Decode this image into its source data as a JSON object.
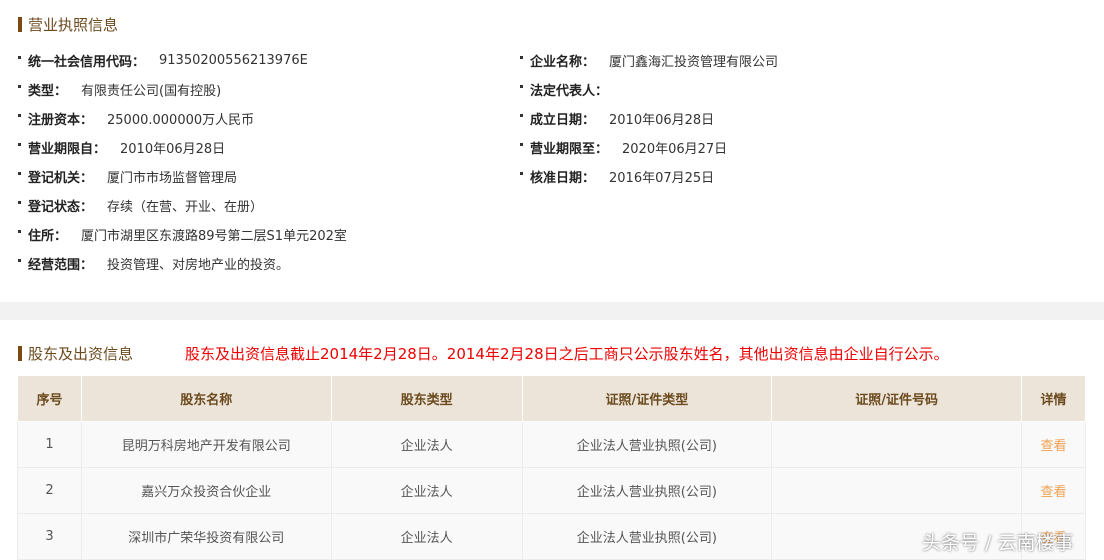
{
  "license": {
    "title": "营业执照信息",
    "left": [
      {
        "label": "统一社会信用代码：",
        "value": "91350200556213976E"
      },
      {
        "label": "类型：",
        "value": "有限责任公司(国有控股)"
      },
      {
        "label": "注册资本：",
        "value": "25000.000000万人民币"
      },
      {
        "label": "营业期限自：",
        "value": "2010年06月28日"
      },
      {
        "label": "登记机关：",
        "value": "厦门市市场监督管理局"
      },
      {
        "label": "登记状态：",
        "value": "存续（在营、开业、在册）"
      },
      {
        "label": "住所：",
        "value": "厦门市湖里区东渡路89号第二层S1单元202室"
      },
      {
        "label": "经营范围：",
        "value": "投资管理、对房地产业的投资。"
      }
    ],
    "right": [
      {
        "label": "企业名称：",
        "value": "厦门鑫海汇投资管理有限公司"
      },
      {
        "label": "法定代表人：",
        "value": ""
      },
      {
        "label": "成立日期：",
        "value": "2010年06月28日"
      },
      {
        "label": "营业期限至：",
        "value": "2020年06月27日"
      },
      {
        "label": "核准日期：",
        "value": "2016年07月25日"
      }
    ]
  },
  "shareholders": {
    "title": "股东及出资信息",
    "notice": "股东及出资信息截止2014年2月28日。2014年2月28日之后工商只公示股东姓名，其他出资信息由企业自行公示。",
    "headers": [
      "序号",
      "股东名称",
      "股东类型",
      "证照/证件类型",
      "证照/证件号码",
      "详情"
    ],
    "rows": [
      [
        "1",
        "昆明万科房地产开发有限公司",
        "企业法人",
        "企业法人营业执照(公司)",
        "",
        "查看"
      ],
      [
        "2",
        "嘉兴万众投资合伙企业",
        "企业法人",
        "企业法人营业执照(公司)",
        "",
        "查看"
      ],
      [
        "3",
        "深圳市广荣华投资有限公司",
        "企业法人",
        "企业法人营业执照(公司)",
        "",
        "查看"
      ]
    ]
  },
  "watermark": "头条号 / 云南楼事"
}
